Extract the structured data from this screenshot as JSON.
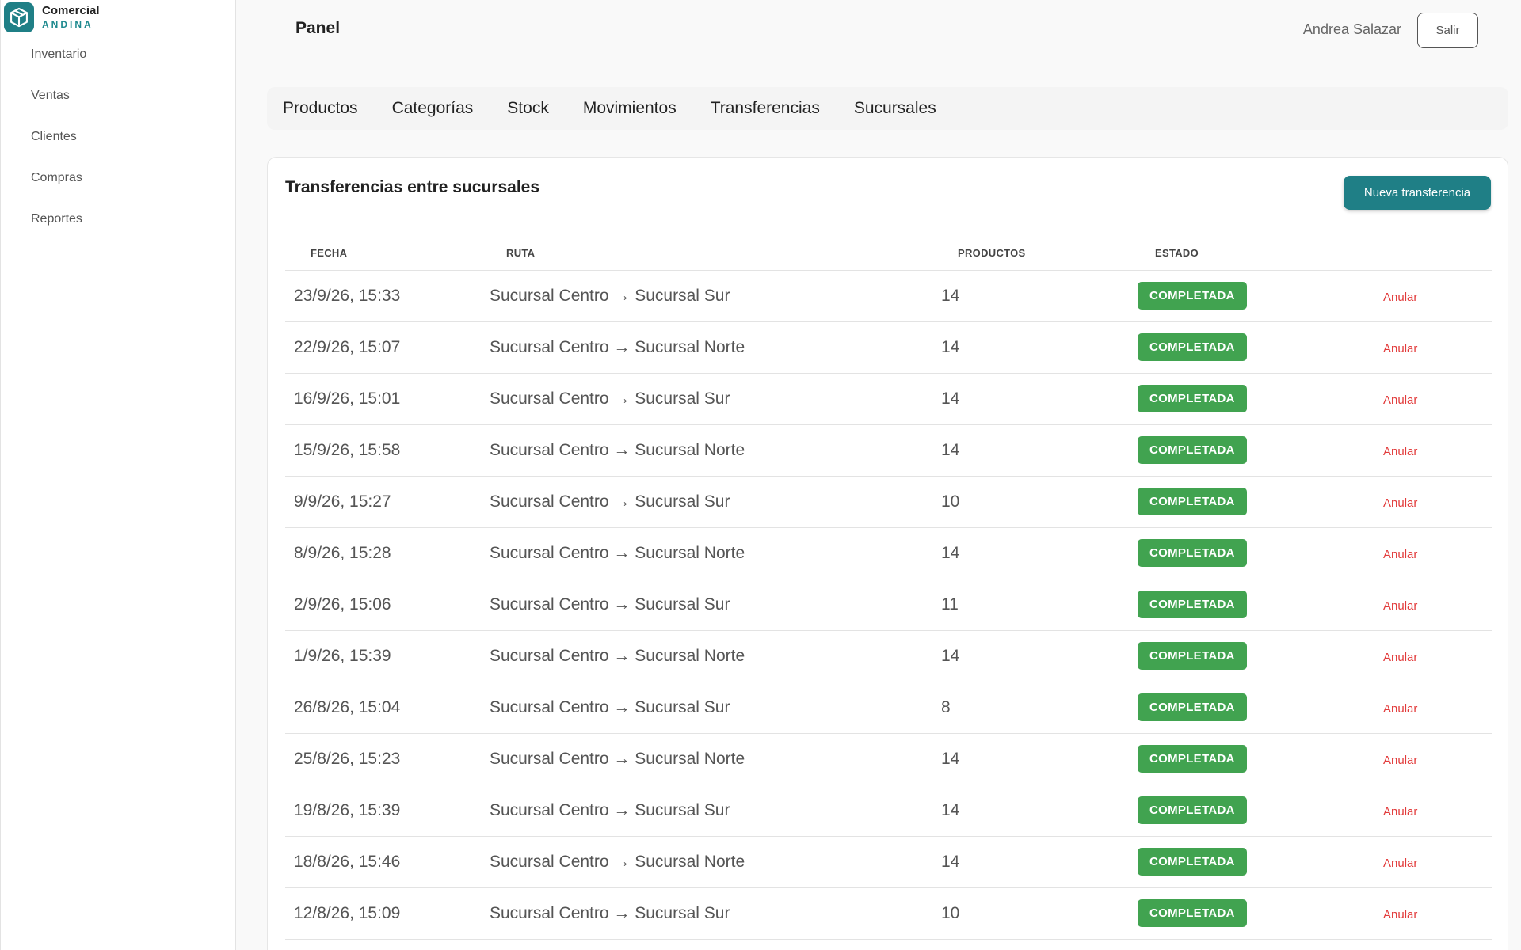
{
  "brand": {
    "name": "Comercial",
    "subtitle": "ANDINA",
    "logo_icon": "cube-icon",
    "color": "#1f7f86"
  },
  "sidebar": {
    "items": [
      {
        "label": "Inventario"
      },
      {
        "label": "Ventas"
      },
      {
        "label": "Clientes"
      },
      {
        "label": "Compras"
      },
      {
        "label": "Reportes"
      }
    ]
  },
  "header": {
    "title": "Panel",
    "user": "Andrea Salazar",
    "logout_label": "Salir"
  },
  "tabs": [
    {
      "label": "Productos"
    },
    {
      "label": "Categorías"
    },
    {
      "label": "Stock"
    },
    {
      "label": "Movimientos"
    },
    {
      "label": "Transferencias"
    },
    {
      "label": "Sucursales"
    }
  ],
  "transfers": {
    "title": "Transferencias entre sucursales",
    "new_button": "Nueva transferencia",
    "columns": {
      "fecha": "FECHA",
      "ruta": "RUTA",
      "productos": "PRODUCTOS",
      "estado": "ESTADO"
    },
    "action_label": "Anular",
    "status_color": "#41a350",
    "rows": [
      {
        "fecha": "23/9/26, 15:33",
        "ruta": "Sucursal Centro → Sucursal Sur",
        "productos": "14",
        "estado": "COMPLETADA"
      },
      {
        "fecha": "22/9/26, 15:07",
        "ruta": "Sucursal Centro → Sucursal Norte",
        "productos": "14",
        "estado": "COMPLETADA"
      },
      {
        "fecha": "16/9/26, 15:01",
        "ruta": "Sucursal Centro → Sucursal Sur",
        "productos": "14",
        "estado": "COMPLETADA"
      },
      {
        "fecha": "15/9/26, 15:58",
        "ruta": "Sucursal Centro → Sucursal Norte",
        "productos": "14",
        "estado": "COMPLETADA"
      },
      {
        "fecha": "9/9/26, 15:27",
        "ruta": "Sucursal Centro → Sucursal Sur",
        "productos": "10",
        "estado": "COMPLETADA"
      },
      {
        "fecha": "8/9/26, 15:28",
        "ruta": "Sucursal Centro → Sucursal Norte",
        "productos": "14",
        "estado": "COMPLETADA"
      },
      {
        "fecha": "2/9/26, 15:06",
        "ruta": "Sucursal Centro → Sucursal Sur",
        "productos": "11",
        "estado": "COMPLETADA"
      },
      {
        "fecha": "1/9/26, 15:39",
        "ruta": "Sucursal Centro → Sucursal Norte",
        "productos": "14",
        "estado": "COMPLETADA"
      },
      {
        "fecha": "26/8/26, 15:04",
        "ruta": "Sucursal Centro → Sucursal Sur",
        "productos": "8",
        "estado": "COMPLETADA"
      },
      {
        "fecha": "25/8/26, 15:23",
        "ruta": "Sucursal Centro → Sucursal Norte",
        "productos": "14",
        "estado": "COMPLETADA"
      },
      {
        "fecha": "19/8/26, 15:39",
        "ruta": "Sucursal Centro → Sucursal Sur",
        "productos": "14",
        "estado": "COMPLETADA"
      },
      {
        "fecha": "18/8/26, 15:46",
        "ruta": "Sucursal Centro → Sucursal Norte",
        "productos": "14",
        "estado": "COMPLETADA"
      },
      {
        "fecha": "12/8/26, 15:09",
        "ruta": "Sucursal Centro → Sucursal Sur",
        "productos": "10",
        "estado": "COMPLETADA"
      }
    ]
  }
}
